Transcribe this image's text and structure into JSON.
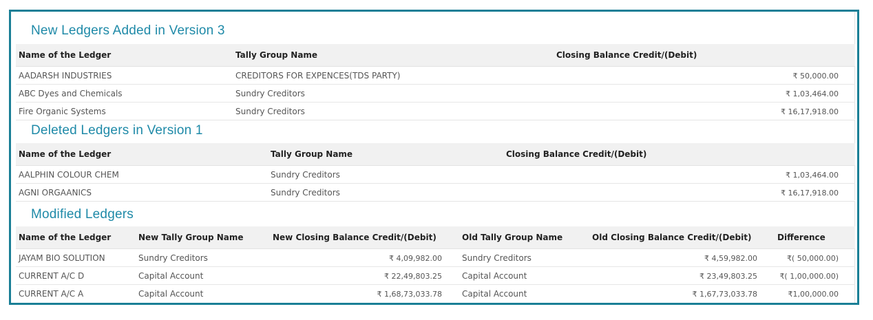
{
  "new_ledgers": {
    "title": "New Ledgers Added in Version 3",
    "columns": [
      "Name of the Ledger",
      "Tally Group Name",
      "Closing Balance Credit/(Debit)"
    ],
    "rows": [
      {
        "name": "AADARSH INDUSTRIES",
        "group": "CREDITORS FOR EXPENCES(TDS PARTY)",
        "balance": "₹ 50,000.00"
      },
      {
        "name": "ABC Dyes and Chemicals",
        "group": "Sundry Creditors",
        "balance": "₹ 1,03,464.00"
      },
      {
        "name": "Fire Organic Systems",
        "group": "Sundry Creditors",
        "balance": "₹ 16,17,918.00"
      }
    ]
  },
  "deleted_ledgers": {
    "title": "Deleted Ledgers in Version 1",
    "columns": [
      "Name of the Ledger",
      "Tally Group Name",
      "Closing Balance Credit/(Debit)"
    ],
    "rows": [
      {
        "name": "AALPHIN COLOUR CHEM",
        "group": "Sundry Creditors",
        "balance": "₹ 1,03,464.00"
      },
      {
        "name": "AGNI ORGAANICS",
        "group": "Sundry Creditors",
        "balance": "₹ 16,17,918.00"
      }
    ]
  },
  "modified_ledgers": {
    "title": "Modified Ledgers",
    "columns": [
      "Name of the Ledger",
      "New Tally Group Name",
      "New Closing Balance Credit/(Debit)",
      "Old Tally Group Name",
      "Old Closing Balance Credit/(Debit)",
      "Difference"
    ],
    "rows": [
      {
        "name": "JAYAM BIO SOLUTION",
        "new_group": "Sundry Creditors",
        "new_balance": "₹ 4,09,982.00",
        "old_group": "Sundry Creditors",
        "old_balance": "₹ 4,59,982.00",
        "difference": "₹( 50,000.00)"
      },
      {
        "name": "CURRENT A/C D",
        "new_group": "Capital Account",
        "new_balance": "₹ 22,49,803.25",
        "old_group": "Capital Account",
        "old_balance": "₹ 23,49,803.25",
        "difference": "₹( 1,00,000.00)"
      },
      {
        "name": "CURRENT A/C A",
        "new_group": "Capital Account",
        "new_balance": "₹ 1,68,73,033.78",
        "old_group": "Capital Account",
        "old_balance": "₹ 1,67,73,033.78",
        "difference": "₹1,00,000.00"
      }
    ]
  }
}
